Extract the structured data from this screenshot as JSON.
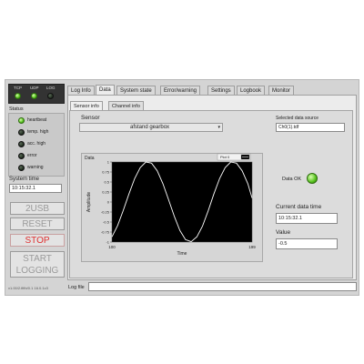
{
  "indicators": {
    "tcp": "TCP",
    "udp": "UDP",
    "log": "LOG"
  },
  "status": {
    "title": "Status",
    "items": [
      {
        "label": "heartbeat",
        "state": "on"
      },
      {
        "label": "temp. high",
        "state": "off"
      },
      {
        "label": "acc. high",
        "state": "off"
      },
      {
        "label": "error",
        "state": "off"
      },
      {
        "label": "warning",
        "state": "off"
      }
    ]
  },
  "system_time": {
    "label": "System time",
    "value": "10:15:32.1"
  },
  "buttons": {
    "usb": "2USB",
    "reset": "RESET",
    "stop": "STOP",
    "start_logging_line1": "START",
    "start_logging_line2": "LOGGING"
  },
  "version": "v1.00/2.fifth/0.1 16.0.1c3",
  "tabs": [
    "Log Info",
    "Data",
    "System state",
    "Error/warning",
    "Settings",
    "Logbook",
    "Monitor"
  ],
  "active_tab": "Data",
  "subtabs": [
    "Sensor info",
    "Channel info"
  ],
  "active_subtab": "Sensor info",
  "sensor": {
    "label": "Sensor",
    "value": "afstand gearbox"
  },
  "data_source": {
    "label": "Selected data source",
    "value": "Ch0(1).tdf"
  },
  "data_ok": {
    "label": "Data OK",
    "state": "on"
  },
  "current_data_time": {
    "label": "Current data time",
    "value": "10:15:32.1"
  },
  "value": {
    "label": "Value",
    "value": "-0.5"
  },
  "log_file": {
    "label": "Log file",
    "value": ""
  },
  "colors": {
    "panel": "#d4d4d4",
    "led_green": "#56c21d",
    "stop_text": "#e03030",
    "plot_bg": "#000000",
    "trace": "#ffffff"
  },
  "chart_data": {
    "type": "line",
    "title": "Data",
    "xlabel": "Time",
    "ylabel": "Amplitude",
    "xlim": [
      100,
      199
    ],
    "ylim": [
      -1,
      1
    ],
    "x_tick_labels": [
      "100",
      "199"
    ],
    "y_ticks": [
      1,
      0.75,
      0.5,
      0.25,
      0,
      -0.25,
      -0.5,
      -0.75,
      -1
    ],
    "y_tick_labels": [
      "1",
      "0.75",
      "0.5",
      "0.25",
      "0",
      "-0.25",
      "-0.5",
      "-0.75",
      "-1"
    ],
    "legend": "Plot 0",
    "series": [
      {
        "name": "Plot 0",
        "x": [
          100,
          104,
          108,
          112,
          116,
          120,
          124,
          128,
          132,
          136,
          140,
          144,
          148,
          152,
          156,
          160,
          164,
          168,
          172,
          176,
          180,
          184,
          188,
          192,
          196,
          199
        ],
        "y": [
          -0.87,
          -0.59,
          -0.21,
          0.2,
          0.58,
          0.86,
          1,
          0.97,
          0.78,
          0.46,
          0.06,
          -0.35,
          -0.71,
          -0.94,
          -0.99,
          -0.87,
          -0.6,
          -0.22,
          0.2,
          0.58,
          0.86,
          1,
          0.97,
          0.78,
          0.46,
          0.1
        ]
      }
    ],
    "grid": false
  }
}
